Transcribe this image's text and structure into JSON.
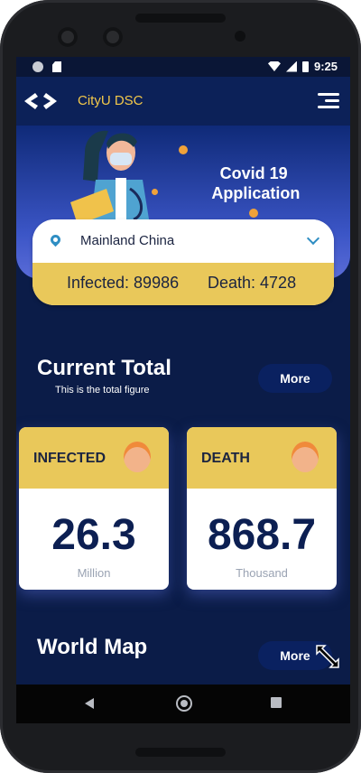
{
  "status_bar": {
    "time": "9:25"
  },
  "app_bar": {
    "title": "CityU DSC"
  },
  "hero": {
    "title": "Covid 19\n Application"
  },
  "location": {
    "selected": "Mainland China"
  },
  "summary": {
    "infected_text": "Infected: 89986",
    "death_text": "Death: 4728"
  },
  "current_total": {
    "title": "Current Total",
    "subtitle": "This is the total figure",
    "more_label": "More"
  },
  "cards": [
    {
      "label": "INFECTED",
      "value": "26.3",
      "unit": "Million"
    },
    {
      "label": "DEATH",
      "value": "868.7",
      "unit": "Thousand"
    }
  ],
  "world_map": {
    "title": "World Map",
    "more_label": "More"
  },
  "colors": {
    "accent_yellow": "#e9c85a",
    "navy": "#0b1c48",
    "title_gold": "#f3c84a"
  }
}
